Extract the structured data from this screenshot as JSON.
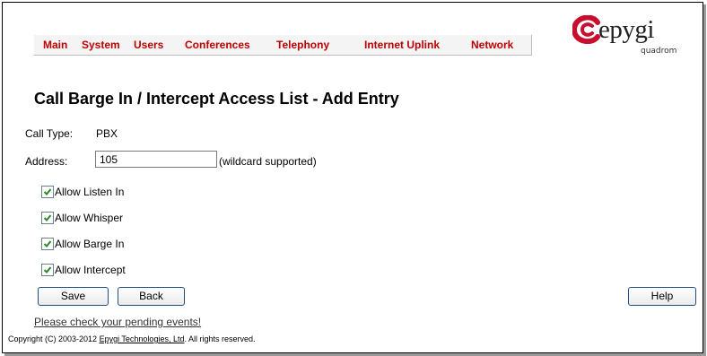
{
  "nav": {
    "items": [
      "Main",
      "System",
      "Users",
      "Conferences",
      "Telephony",
      "Internet Uplink",
      "Network"
    ]
  },
  "logo": {
    "name": "epygi",
    "sub": "quadrom",
    "color": "#c8102e"
  },
  "page": {
    "title": "Call Barge In / Intercept Access List - Add Entry"
  },
  "form": {
    "call_type_label": "Call Type:",
    "call_type_value": "PBX",
    "address_label": "Address:",
    "address_value": "105",
    "address_hint": "(wildcard supported)",
    "checkboxes": [
      {
        "label": "Allow Listen In",
        "checked": true
      },
      {
        "label": "Allow Whisper",
        "checked": true
      },
      {
        "label": "Allow Barge In",
        "checked": true
      },
      {
        "label": "Allow Intercept",
        "checked": true
      }
    ]
  },
  "buttons": {
    "save": "Save",
    "back": "Back",
    "help": "Help"
  },
  "footer": {
    "pending_link": "Please check your pending events!",
    "copyright_prefix": "Copyright (C) 2003-2012 ",
    "company": "Epygi Technologies, Ltd",
    "copyright_suffix": ". All rights reserved."
  }
}
